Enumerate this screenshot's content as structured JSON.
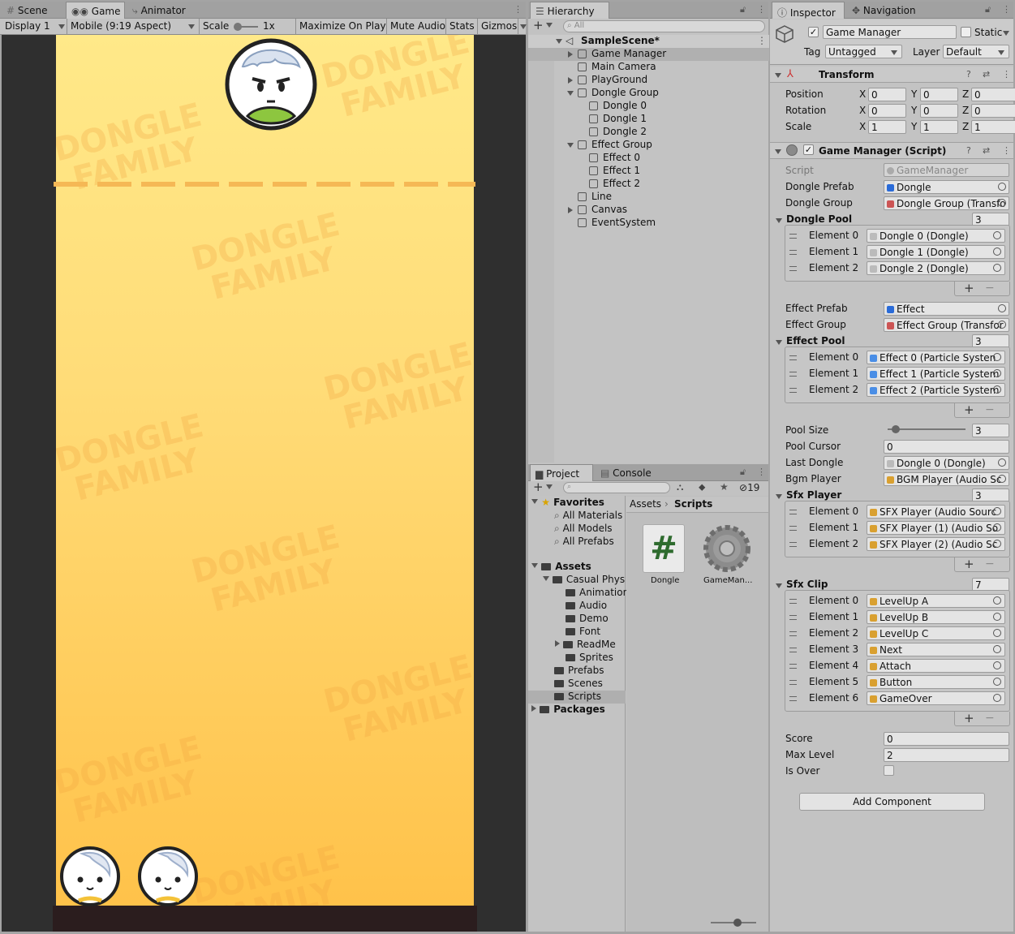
{
  "game_panel": {
    "tabs": [
      {
        "label": "Scene"
      },
      {
        "label": "Game"
      },
      {
        "label": "Animator"
      }
    ],
    "toolbar": {
      "display": "Display 1",
      "aspect": "Mobile (9:19 Aspect)",
      "scale_label": "Scale",
      "scale_value": "1x",
      "maximize": "Maximize On Play",
      "mute": "Mute Audio",
      "stats": "Stats",
      "gizmos": "Gizmos"
    },
    "watermark": "DONGLE\nFAMILY",
    "colors": {
      "bg_top": "#ffe989",
      "bg_bottom": "#ffc24a",
      "floor": "#2b1d1e",
      "line": "#f5b855"
    }
  },
  "hierarchy": {
    "title": "Hierarchy",
    "search_placeholder": "All",
    "scene": "SampleScene*",
    "items": [
      {
        "label": "Game Manager"
      },
      {
        "label": "Main Camera"
      },
      {
        "label": "PlayGround"
      },
      {
        "label": "Dongle Group"
      },
      {
        "label": "Dongle 0"
      },
      {
        "label": "Dongle 1"
      },
      {
        "label": "Dongle 2"
      },
      {
        "label": "Effect Group"
      },
      {
        "label": "Effect 0"
      },
      {
        "label": "Effect 1"
      },
      {
        "label": "Effect 2"
      },
      {
        "label": "Line"
      },
      {
        "label": "Canvas"
      },
      {
        "label": "EventSystem"
      }
    ]
  },
  "project": {
    "tabs": [
      {
        "label": "Project"
      },
      {
        "label": "Console"
      }
    ],
    "hidden_count": "19",
    "favorites": {
      "label": "Favorites",
      "items": [
        "All Materials",
        "All Models",
        "All Prefabs"
      ]
    },
    "assets": {
      "label": "Assets",
      "items": [
        "Casual Phys",
        "Animation",
        "Audio",
        "Demo",
        "Font",
        "ReadMe",
        "Sprites",
        "Prefabs",
        "Scenes",
        "Scripts"
      ]
    },
    "packages": "Packages",
    "breadcrumb": {
      "root": "Assets",
      "current": "Scripts"
    },
    "files": [
      {
        "name": "Dongle"
      },
      {
        "name": "GameMan..."
      }
    ]
  },
  "inspector": {
    "tabs": [
      {
        "label": "Inspector"
      },
      {
        "label": "Navigation"
      }
    ],
    "object_name": "Game Manager",
    "static_label": "Static",
    "tag_label": "Tag",
    "tag_value": "Untagged",
    "layer_label": "Layer",
    "layer_value": "Default",
    "transform": {
      "title": "Transform",
      "rows": [
        {
          "label": "Position",
          "x": "0",
          "y": "0",
          "z": "0"
        },
        {
          "label": "Rotation",
          "x": "0",
          "y": "0",
          "z": "0"
        },
        {
          "label": "Scale",
          "x": "1",
          "y": "1",
          "z": "1"
        }
      ],
      "axes": [
        "X",
        "Y",
        "Z"
      ]
    },
    "script": {
      "title": "Game Manager (Script)",
      "script_label": "Script",
      "script_value": "GameManager",
      "dongle_prefab_label": "Dongle Prefab",
      "dongle_prefab_value": "Dongle",
      "dongle_group_label": "Dongle Group",
      "dongle_group_value": "Dongle Group (Transfo",
      "dongle_pool": {
        "label": "Dongle Pool",
        "count": "3",
        "elements": [
          {
            "label": "Element 0",
            "value": "Dongle 0 (Dongle)"
          },
          {
            "label": "Element 1",
            "value": "Dongle 1 (Dongle)"
          },
          {
            "label": "Element 2",
            "value": "Dongle 2 (Dongle)"
          }
        ]
      },
      "effect_prefab_label": "Effect Prefab",
      "effect_prefab_value": "Effect",
      "effect_group_label": "Effect Group",
      "effect_group_value": "Effect Group (Transfor",
      "effect_pool": {
        "label": "Effect Pool",
        "count": "3",
        "elements": [
          {
            "label": "Element 0",
            "value": "Effect 0 (Particle Systen"
          },
          {
            "label": "Element 1",
            "value": "Effect 1 (Particle System"
          },
          {
            "label": "Element 2",
            "value": "Effect 2 (Particle System"
          }
        ]
      },
      "pool_size_label": "Pool Size",
      "pool_size_value": "3",
      "pool_size_fraction": 0.05,
      "pool_cursor_label": "Pool Cursor",
      "pool_cursor_value": "0",
      "last_dongle_label": "Last Dongle",
      "last_dongle_value": "Dongle 0 (Dongle)",
      "bgm_label": "Bgm Player",
      "bgm_value": "BGM Player (Audio Sc",
      "sfx_player": {
        "label": "Sfx Player",
        "count": "3",
        "elements": [
          {
            "label": "Element 0",
            "value": "SFX Player (Audio Sourc"
          },
          {
            "label": "Element 1",
            "value": "SFX Player (1) (Audio So"
          },
          {
            "label": "Element 2",
            "value": "SFX Player (2) (Audio Sc"
          }
        ]
      },
      "sfx_clip": {
        "label": "Sfx Clip",
        "count": "7",
        "elements": [
          {
            "label": "Element 0",
            "value": "LevelUp A"
          },
          {
            "label": "Element 1",
            "value": "LevelUp B"
          },
          {
            "label": "Element 2",
            "value": "LevelUp C"
          },
          {
            "label": "Element 3",
            "value": "Next"
          },
          {
            "label": "Element 4",
            "value": "Attach"
          },
          {
            "label": "Element 5",
            "value": "Button"
          },
          {
            "label": "Element 6",
            "value": "GameOver"
          }
        ]
      },
      "score_label": "Score",
      "score_value": "0",
      "max_level_label": "Max Level",
      "max_level_value": "2",
      "is_over_label": "Is Over"
    },
    "add_component": "Add Component"
  }
}
